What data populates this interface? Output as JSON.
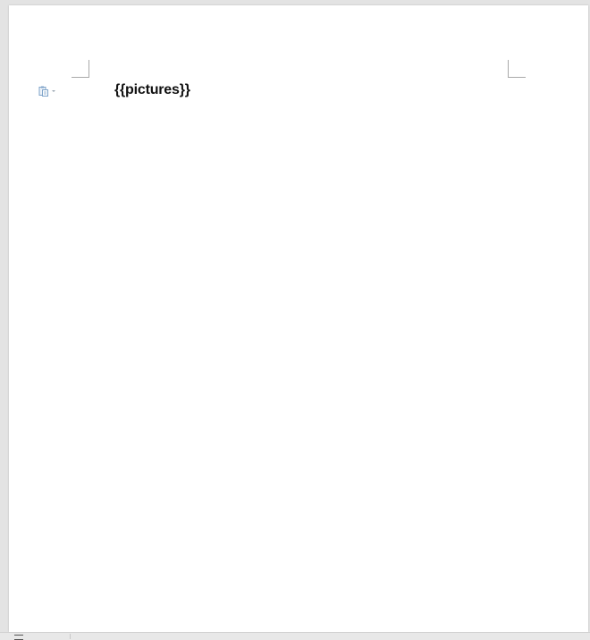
{
  "document": {
    "placeholder_text": "{{pictures}}"
  },
  "icons": {
    "paste_options": "paste-options-icon",
    "dropdown": "chevron-down-icon",
    "status_view": "page-view-icon"
  },
  "colors": {
    "page_background": "#ffffff",
    "workspace_background": "#e3e3e3",
    "margin_marker": "#a8a8a8",
    "text": "#111111",
    "paste_icon": "#7ea3c9"
  }
}
